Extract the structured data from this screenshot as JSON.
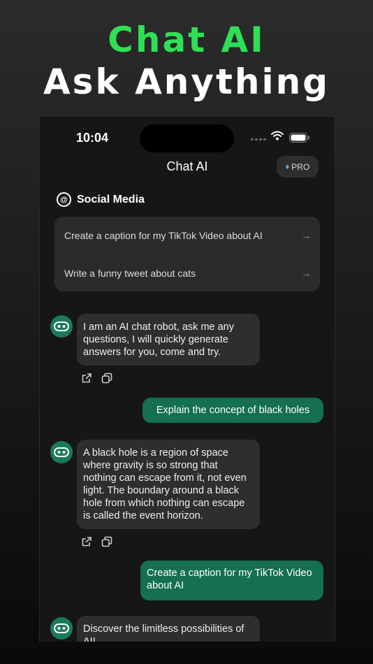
{
  "header": {
    "line1": "Chat AI",
    "line2": "Ask Anything",
    "line1_color": "#2ee055",
    "line2_color": "#ffffff"
  },
  "status_bar": {
    "time": "10:04"
  },
  "nav": {
    "title": "Chat AI",
    "pro_label": "PRO",
    "pro_icon": "gem-icon"
  },
  "section": {
    "icon": "at-sign-icon",
    "title": "Social Media"
  },
  "suggestions": [
    {
      "text": "Create a caption for my TikTok Video about AI",
      "icon": "arrow-right-icon"
    },
    {
      "text": "Write a funny tweet about cats",
      "icon": "arrow-right-icon"
    }
  ],
  "messages": [
    {
      "role": "assistant",
      "text": "I am an AI chat robot, ask me any questions, I will quickly generate answers for you, come and try."
    },
    {
      "role": "user",
      "text": "Explain the concept of black holes"
    },
    {
      "role": "assistant",
      "text": "A black hole is a region of space where gravity is so strong that nothing can escape from it, not even light. The boundary around a black hole from which nothing can escape is called the event horizon."
    },
    {
      "role": "user",
      "text": "Create a caption for my TikTok Video about AI"
    },
    {
      "role": "assistant",
      "text": "Discover the limitless possibilities of AI!"
    }
  ],
  "colors": {
    "accent": "#2ee055",
    "user_bubble": "#14704f",
    "ai_bubble": "#2e2e2e",
    "avatar": "#1c7a57"
  }
}
